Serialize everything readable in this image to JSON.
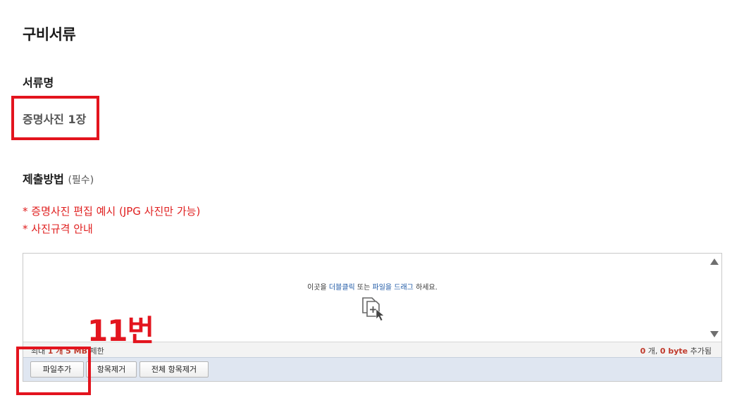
{
  "page": {
    "title": "구비서류",
    "doc_section_label": "서류명",
    "doc_name": "증명사진 1장",
    "submit_method_label": "제출방법",
    "submit_method_required": "(필수)",
    "links": [
      "* 증명사진 편집 예시 (JPG 사진만 가능)",
      "* 사진규격 안내"
    ]
  },
  "uploader": {
    "drop_text_prefix": "이곳을 ",
    "drop_text_dblclick": "더블클릭",
    "drop_text_mid": " 또는 ",
    "drop_text_drag": "파일을 드래그",
    "drop_text_suffix": " 하세요.",
    "limit_prefix": "최대 ",
    "limit_count": "1 개 5 MB",
    "limit_suffix": " 제한",
    "added_count": "0",
    "added_count_unit": " 개, ",
    "added_size": "0 byte",
    "added_suffix": " 추가됨",
    "buttons": {
      "add": "파일추가",
      "remove": "항목제거",
      "remove_all": "전체 항목제거"
    }
  },
  "annotation": {
    "label": "11번",
    "color": "#e3141e"
  },
  "icons": [
    "file-add-icon",
    "scroll-up-icon",
    "scroll-down-icon"
  ]
}
